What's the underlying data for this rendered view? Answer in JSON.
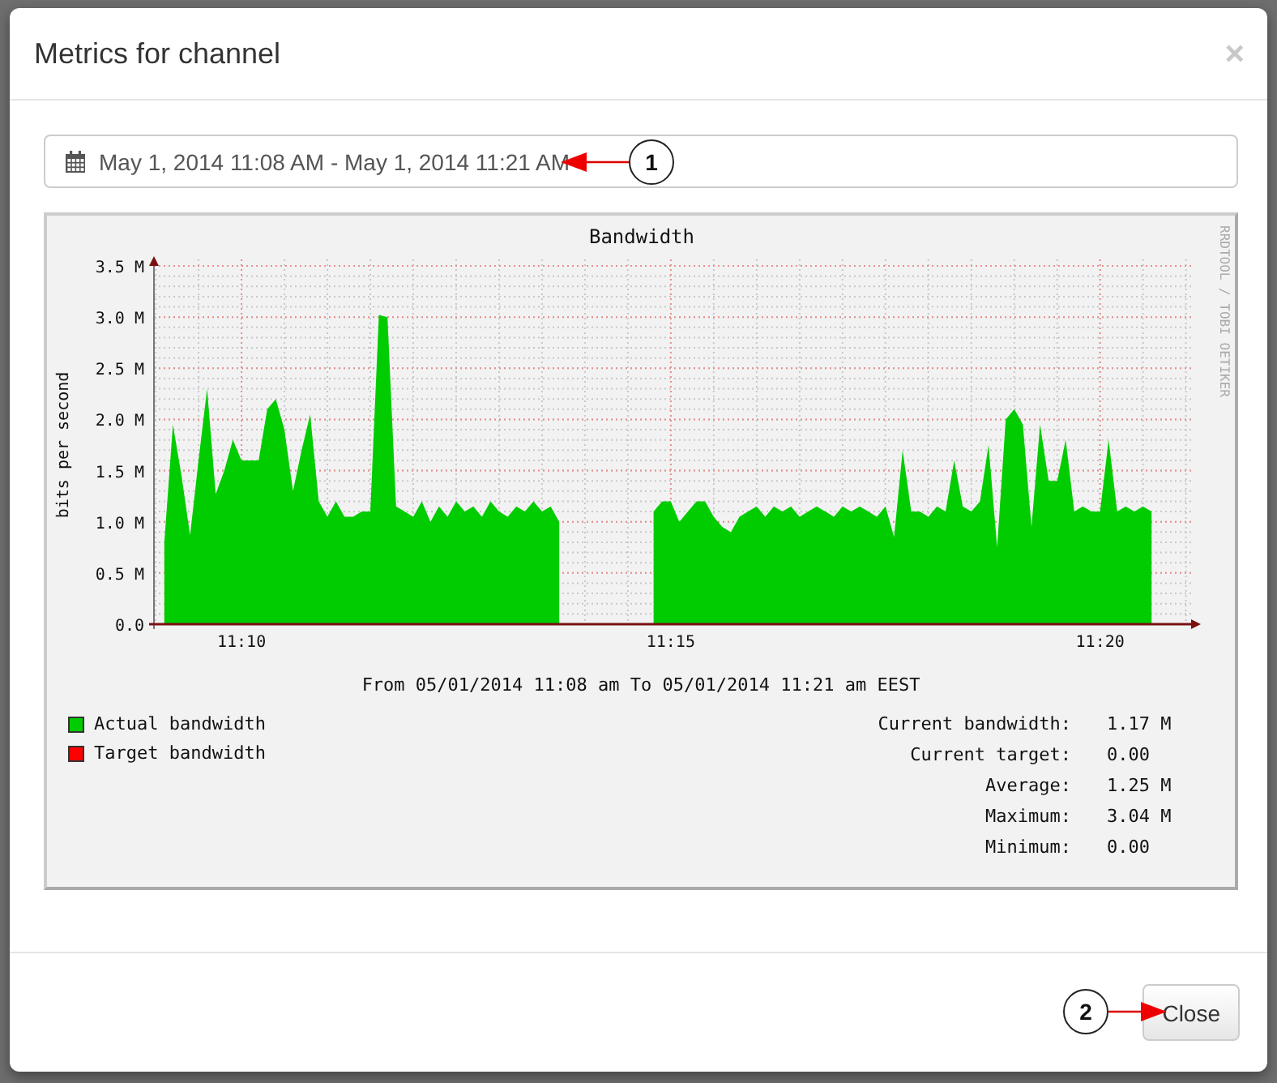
{
  "modal": {
    "title": "Metrics for channel",
    "close_symbol": "×"
  },
  "date_range": {
    "value": "May 1, 2014 11:08 AM - May 1, 2014 11:21 AM"
  },
  "graph": {
    "watermark": "RRDTOOL / TOBI OETIKER",
    "range_caption": "From 05/01/2014 11:08 am To 05/01/2014 11:21 am EEST",
    "chart_data": {
      "type": "area",
      "title": "Bandwidth",
      "ylabel": "bits per second",
      "categories": [
        null,
        null,
        null,
        null,
        null,
        null,
        null,
        null,
        null,
        "11:10",
        null,
        null,
        null,
        null,
        null,
        null,
        null,
        null,
        null,
        null,
        null,
        null,
        null,
        null,
        null,
        null,
        null,
        null,
        null,
        null,
        null,
        null,
        null,
        null,
        null,
        null,
        null,
        null,
        null,
        null,
        null,
        null,
        null,
        null,
        null,
        null,
        null,
        null,
        null,
        null,
        null,
        null,
        null,
        null,
        null,
        null,
        null,
        null,
        null,
        "11:15",
        null,
        null,
        null,
        null,
        null,
        null,
        null,
        null,
        null,
        null,
        null,
        null,
        null,
        null,
        null,
        null,
        null,
        null,
        null,
        null,
        null,
        null,
        null,
        null,
        null,
        null,
        null,
        null,
        null,
        null,
        null,
        null,
        null,
        null,
        null,
        null,
        null,
        null,
        null,
        null,
        null,
        null,
        null,
        null,
        null,
        null,
        null,
        null,
        null,
        "11:20",
        null,
        null,
        null,
        null,
        null,
        null
      ],
      "series": [
        {
          "color": "#00cc00",
          "values": [
            0.8,
            1.95,
            1.45,
            0.87,
            1.6,
            2.3,
            1.27,
            1.5,
            1.8,
            1.6,
            1.6,
            1.6,
            2.1,
            2.2,
            1.9,
            1.3,
            1.7,
            2.05,
            1.2,
            1.05,
            1.2,
            1.05,
            1.05,
            1.1,
            1.1,
            3.02,
            3.0,
            1.15,
            1.1,
            1.05,
            1.2,
            1.0,
            1.15,
            1.05,
            1.2,
            1.1,
            1.15,
            1.05,
            1.2,
            1.1,
            1.05,
            1.15,
            1.1,
            1.2,
            1.1,
            1.15,
            1.0,
            null,
            null,
            null,
            null,
            null,
            null,
            null,
            null,
            null,
            null,
            1.1,
            1.2,
            1.2,
            1.0,
            1.1,
            1.2,
            1.2,
            1.05,
            0.95,
            0.9,
            1.05,
            1.1,
            1.15,
            1.05,
            1.15,
            1.1,
            1.15,
            1.05,
            1.1,
            1.15,
            1.1,
            1.05,
            1.15,
            1.1,
            1.15,
            1.1,
            1.05,
            1.15,
            0.85,
            1.7,
            1.1,
            1.1,
            1.05,
            1.15,
            1.1,
            1.6,
            1.15,
            1.1,
            1.2,
            1.75,
            0.75,
            2.0,
            2.1,
            1.95,
            0.95,
            1.95,
            1.4,
            1.4,
            1.8,
            1.1,
            1.15,
            1.1,
            1.1,
            1.8,
            1.1,
            1.15,
            1.1,
            1.15,
            1.1
          ]
        }
      ],
      "ylim": [
        0,
        3.5
      ],
      "grid": true,
      "yticks": [
        {
          "value": 0,
          "label": "0.0"
        },
        {
          "value": 0.5,
          "label": "0.5 M"
        },
        {
          "value": 1,
          "label": "1.0 M"
        },
        {
          "value": 1.5,
          "label": "1.5 M"
        },
        {
          "value": 2,
          "label": "2.0 M"
        },
        {
          "value": 2.5,
          "label": "2.5 M"
        },
        {
          "value": 3,
          "label": "3.0 M"
        },
        {
          "value": 3.5,
          "label": "3.5 M"
        }
      ]
    },
    "legend": [
      {
        "label": "Actual bandwidth",
        "color": "#00cc00"
      },
      {
        "label": "Target bandwidth",
        "color": "#ff0000"
      }
    ],
    "stats": [
      {
        "label": "Current bandwidth:",
        "value": "1.17 M"
      },
      {
        "label": "Current target:",
        "value": "0.00"
      },
      {
        "label": "Average:",
        "value": "1.25 M"
      },
      {
        "label": "Maximum:",
        "value": "3.04 M"
      },
      {
        "label": "Minimum:",
        "value": "0.00"
      }
    ]
  },
  "footer": {
    "button": "Close"
  },
  "callouts": [
    {
      "number": "1"
    },
    {
      "number": "2"
    }
  ]
}
